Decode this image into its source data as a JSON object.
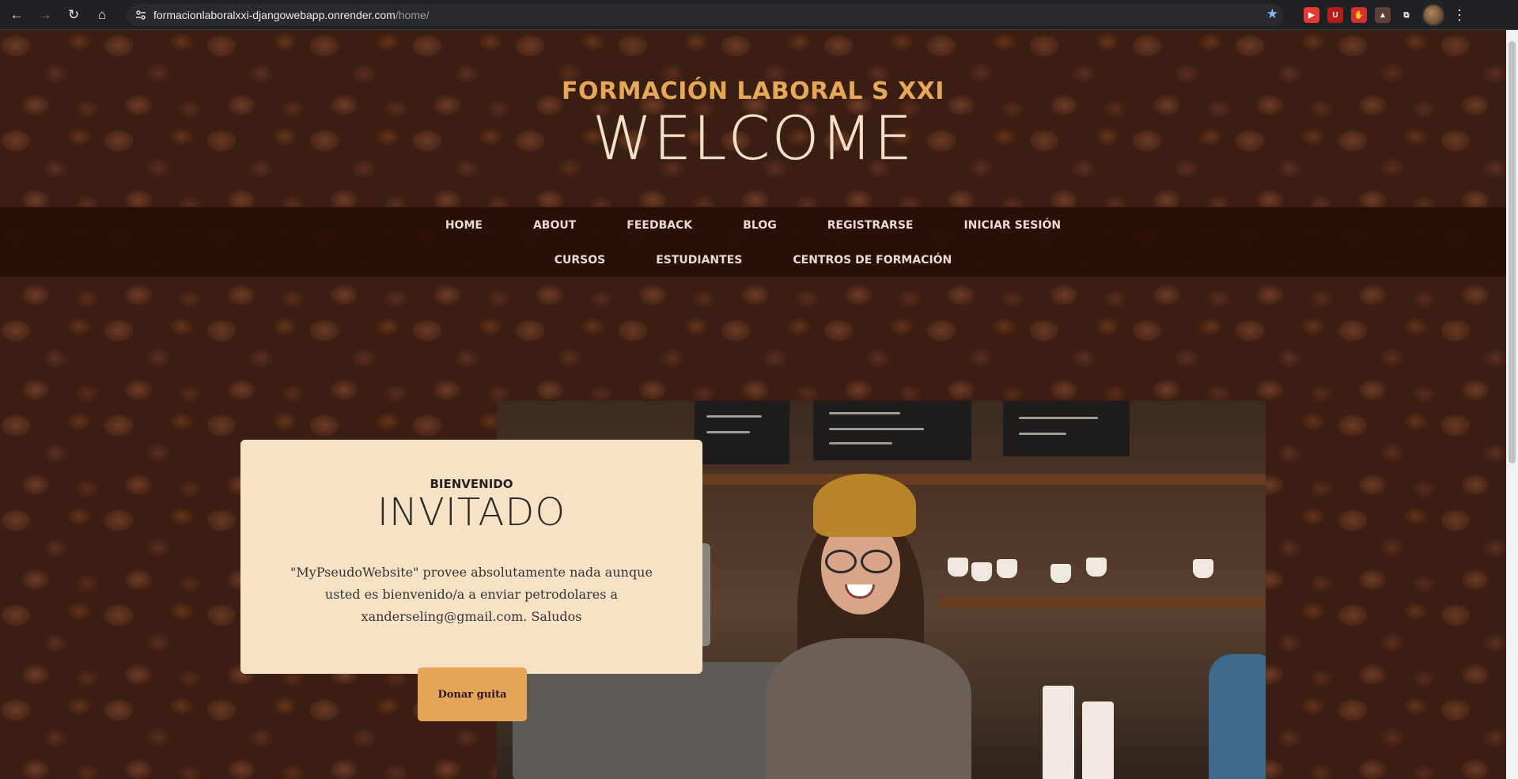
{
  "browser": {
    "url_host": "formacionlaboralxxi-djangowebapp.onrender.com",
    "url_path": "/home/",
    "back_icon": "←",
    "forward_icon": "→",
    "reload_icon": "↻",
    "home_icon": "⌂",
    "bookmark_icon": "★",
    "menu_icon": "⋮",
    "extensions": [
      {
        "name": "youtube-ext-icon",
        "glyph": "▶",
        "color": "#e53935"
      },
      {
        "name": "ublock-icon",
        "glyph": "U",
        "color": "#b71c1c"
      },
      {
        "name": "hand-ext-icon",
        "glyph": "✋",
        "color": "#d32f2f"
      },
      {
        "name": "arrow-ext-icon",
        "glyph": "▲",
        "color": "#5d4037"
      },
      {
        "name": "puzzle-icon",
        "glyph": "⧉",
        "color": "#202124"
      }
    ]
  },
  "header": {
    "subtitle": "FORMACIÓN LABORAL S XXI",
    "title": "WELCOME"
  },
  "nav": {
    "row1": [
      "HOME",
      "ABOUT",
      "FEEDBACK",
      "BLOG",
      "REGISTRARSE",
      "INICIAR SESIÓN"
    ],
    "row2": [
      "CURSOS",
      "ESTUDIANTES",
      "CENTROS DE FORMACIÓN"
    ]
  },
  "intro": {
    "kicker": "BIENVENIDO",
    "heading": "INVITADO",
    "text": "\"MyPseudoWebsite\" provee absolutamente nada aunque usted es bienvenido/a a enviar petrodolares a xanderseling@gmail.com. Saludos",
    "button": "Donar guita"
  },
  "colors": {
    "accent": "#e6a756",
    "title": "#f3e0c7",
    "card": "#f7e2c6",
    "nav_bg": "#280e08"
  }
}
